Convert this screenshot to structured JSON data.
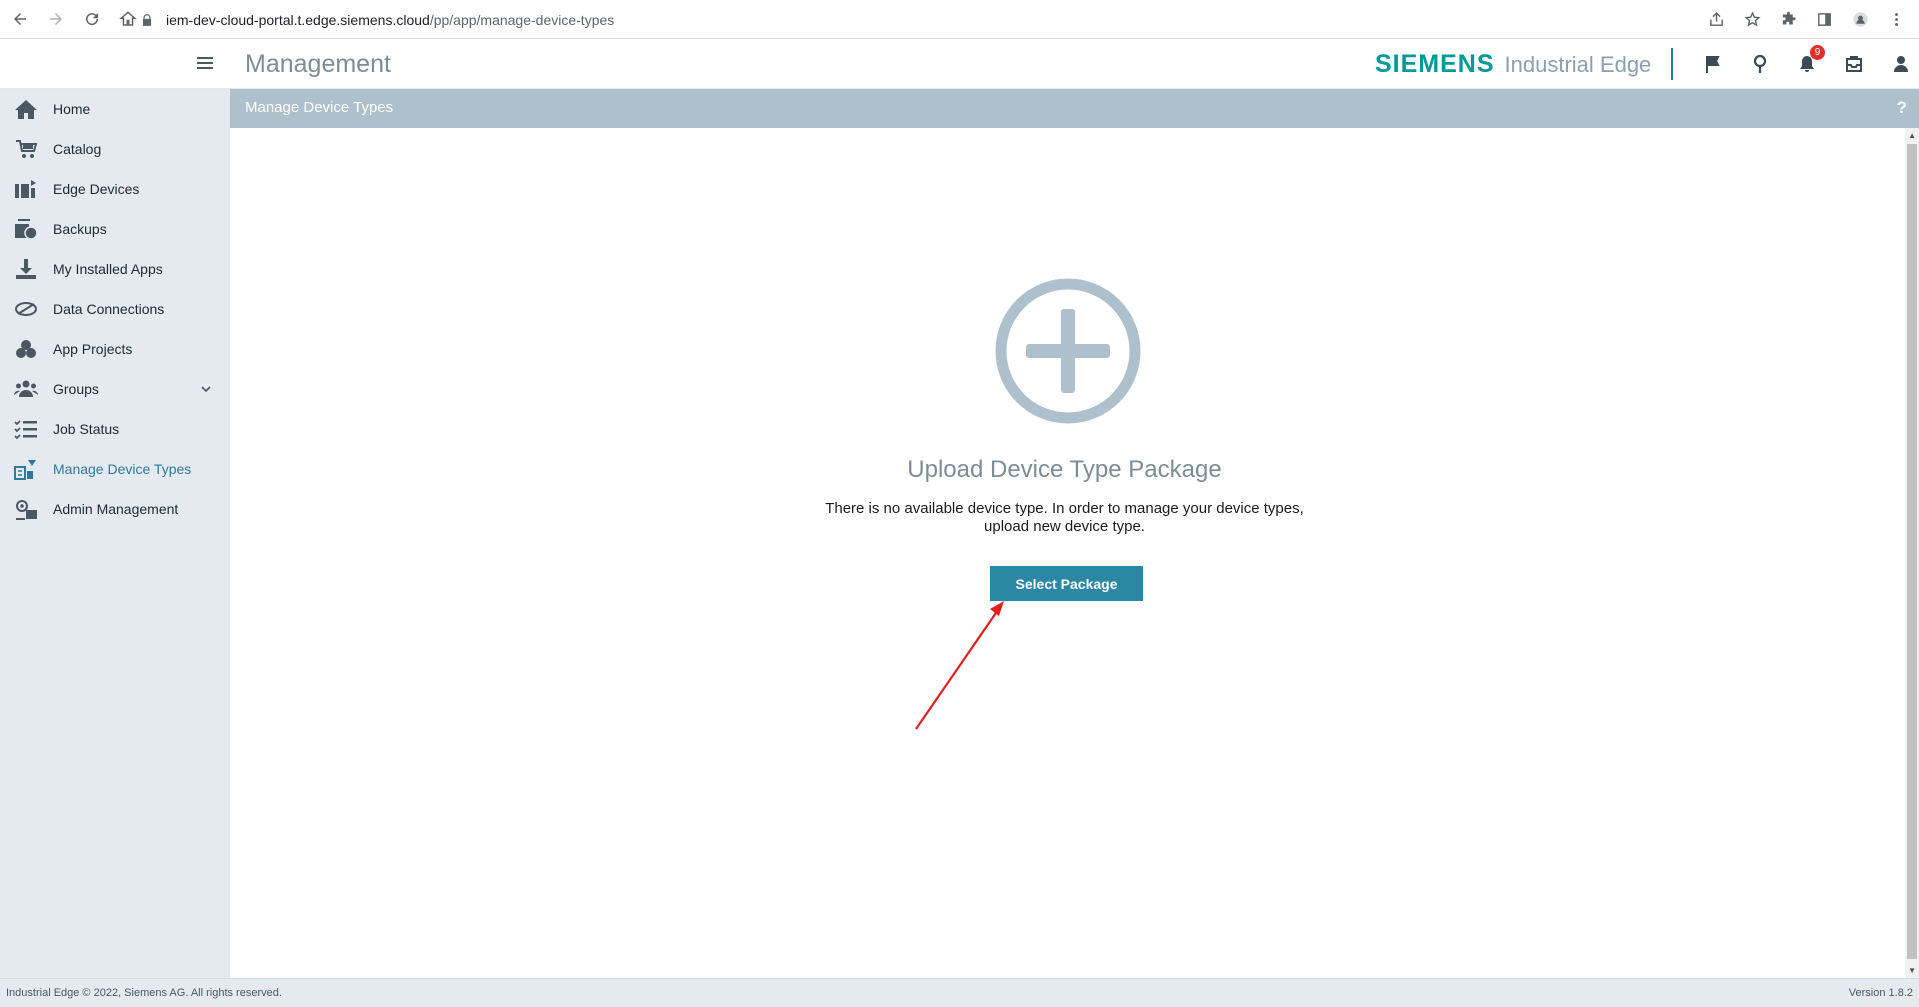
{
  "browser": {
    "url_host": "iem-dev-cloud-portal.t.edge.siemens.cloud",
    "url_path": "/pp/app/manage-device-types"
  },
  "header": {
    "title": "Management",
    "brand_name": "SIEMENS",
    "brand_product": "Industrial Edge",
    "notification_count": "9"
  },
  "sidebar": {
    "items": [
      {
        "label": "Home",
        "icon": "home-icon"
      },
      {
        "label": "Catalog",
        "icon": "catalog-icon"
      },
      {
        "label": "Edge Devices",
        "icon": "edge-devices-icon"
      },
      {
        "label": "Backups",
        "icon": "backups-icon"
      },
      {
        "label": "My Installed Apps",
        "icon": "download-icon"
      },
      {
        "label": "Data Connections",
        "icon": "data-connections-icon"
      },
      {
        "label": "App Projects",
        "icon": "app-projects-icon"
      },
      {
        "label": "Groups",
        "icon": "groups-icon"
      },
      {
        "label": "Job Status",
        "icon": "job-status-icon"
      },
      {
        "label": "Manage Device Types",
        "icon": "manage-device-types-icon"
      },
      {
        "label": "Admin Management",
        "icon": "admin-management-icon"
      }
    ],
    "active_index": 9
  },
  "main": {
    "section_title": "Manage Device Types",
    "help_label": "?",
    "upload_title": "Upload Device Type Package",
    "upload_desc_line1": "There is no available device type. In order to manage your device types,",
    "upload_desc_line2": "upload new device type.",
    "select_button": "Select Package"
  },
  "footer": {
    "copyright": "Industrial Edge © 2022, Siemens AG. All rights reserved.",
    "version": "Version 1.8.2"
  },
  "colors": {
    "accent": "#2b87a4",
    "brand": "#009999",
    "subheader_bg": "#adc0cb",
    "sidebar_bg": "#e5e9f0",
    "annotation": "#e0201c"
  }
}
